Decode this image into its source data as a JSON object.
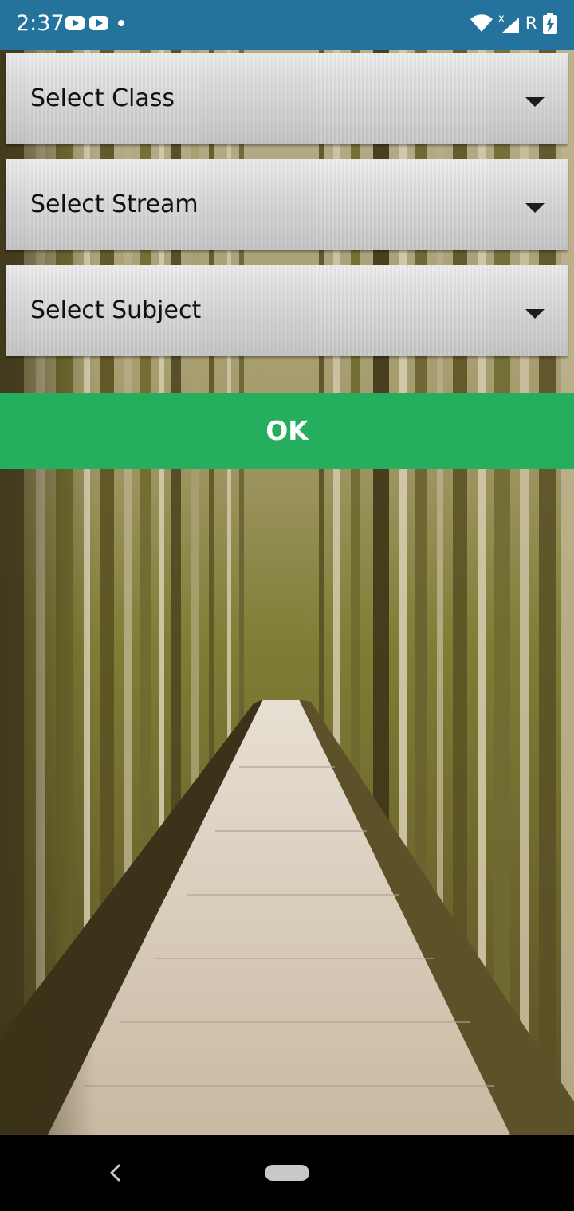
{
  "status_bar": {
    "time": "2:37",
    "roaming_label": "R",
    "icons": [
      "youtube-icon",
      "youtube-icon",
      "notification-dot",
      "wifi-icon",
      "signal-icon",
      "battery-charging-icon"
    ]
  },
  "form": {
    "class_dropdown": {
      "selected": "Select Class"
    },
    "stream_dropdown": {
      "selected": "Select Stream"
    },
    "subject_dropdown": {
      "selected": "Select Subject"
    },
    "ok_button": {
      "label": "OK"
    }
  },
  "colors": {
    "status_bar": "#23739c",
    "ok_button": "#25ae5d",
    "dropdown_bg": "#d8d8d8"
  },
  "navigation": {
    "icons": [
      "back-icon",
      "home-pill"
    ]
  }
}
